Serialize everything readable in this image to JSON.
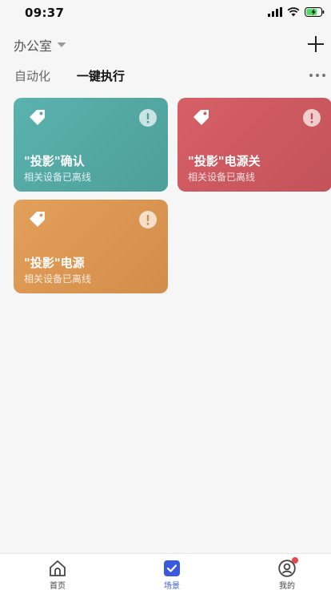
{
  "status_bar": {
    "time": "09:37"
  },
  "header": {
    "room_name": "办公室",
    "dropdown_icon": "caret-down-icon",
    "add_icon": "plus-icon"
  },
  "tabs": {
    "automation_label": "自动化",
    "one_click_label": "一键执行",
    "active": "one_click",
    "more_icon": "more-icon"
  },
  "scenes": [
    {
      "title": "\"投影\"确认",
      "subtitle": "相关设备已离线",
      "color": "#5ab2ae",
      "icon": "tag-icon",
      "status_icon": "alert-icon"
    },
    {
      "title": "\"投影\"电源关",
      "subtitle": "相关设备已离线",
      "color": "#d66066",
      "icon": "tag-icon",
      "status_icon": "alert-icon"
    },
    {
      "title": "\"投影\"电源",
      "subtitle": "相关设备已离线",
      "color": "#e3a05a",
      "icon": "tag-icon",
      "status_icon": "alert-icon"
    }
  ],
  "bottom_nav": {
    "home_label": "首页",
    "scene_label": "场景",
    "mine_label": "我的",
    "active": "scene",
    "accent_color": "#3b58e0",
    "badge_color": "#e5484d"
  }
}
